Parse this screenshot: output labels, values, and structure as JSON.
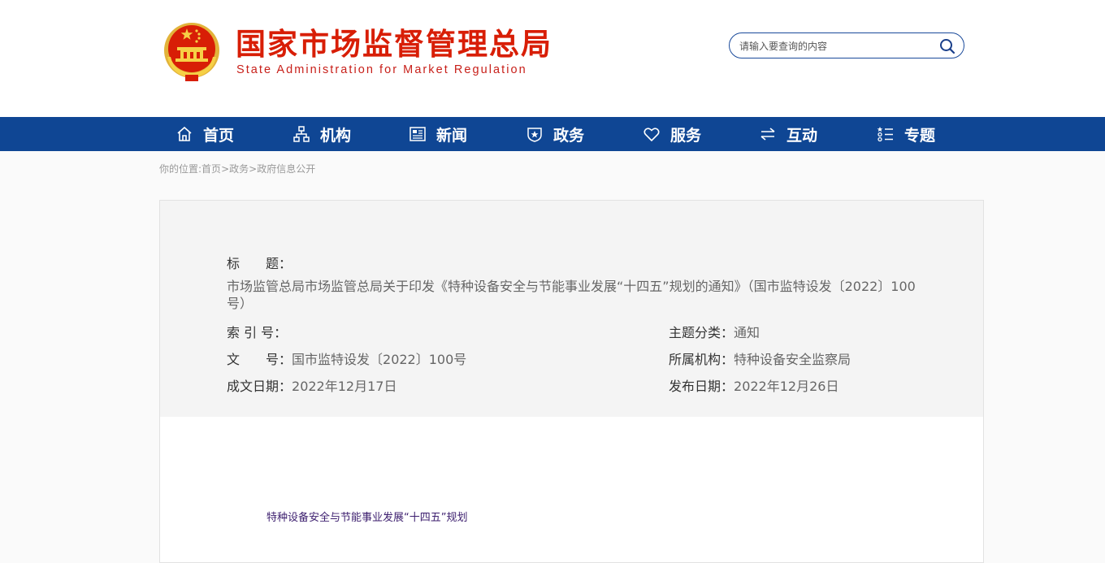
{
  "header": {
    "title": "国家市场监督管理总局",
    "subtitle": "State Administration for Market Regulation",
    "search_placeholder": "请输入要查询的内容"
  },
  "nav": {
    "items": [
      {
        "label": "首页",
        "icon": "home-icon"
      },
      {
        "label": "机构",
        "icon": "org-chart-icon"
      },
      {
        "label": "新闻",
        "icon": "newspaper-icon"
      },
      {
        "label": "政务",
        "icon": "shield-icon"
      },
      {
        "label": "服务",
        "icon": "heart-icon"
      },
      {
        "label": "互动",
        "icon": "exchange-icon"
      },
      {
        "label": "专题",
        "icon": "list-icon"
      }
    ]
  },
  "breadcrumb": {
    "prefix": "你的位置:",
    "items": [
      "首页",
      "政务",
      "政府信息公开"
    ],
    "sep": ">"
  },
  "info": {
    "title_label": "标　　题：",
    "title_value": "市场监管总局市场监管总局关于印发《特种设备安全与节能事业发展“十四五”规划的通知》（国市监特设发〔2022〕100号）",
    "index_label": "索 引 号：",
    "index_value": "",
    "category_label": "主题分类：",
    "category_value": "通知",
    "docno_label": "文　　号：",
    "docno_value": "国市监特设发〔2022〕100号",
    "org_label": "所属机构：",
    "org_value": "特种设备安全监察局",
    "date_label": "成文日期：",
    "date_value": "2022年12月17日",
    "pub_label": "发布日期：",
    "pub_value": "2022年12月26日"
  },
  "content": {
    "heading": "特种设备安全与节能事业发展“十四五”规划"
  },
  "colors": {
    "brand_red": "#d81e06",
    "nav_blue": "#0f4694"
  }
}
